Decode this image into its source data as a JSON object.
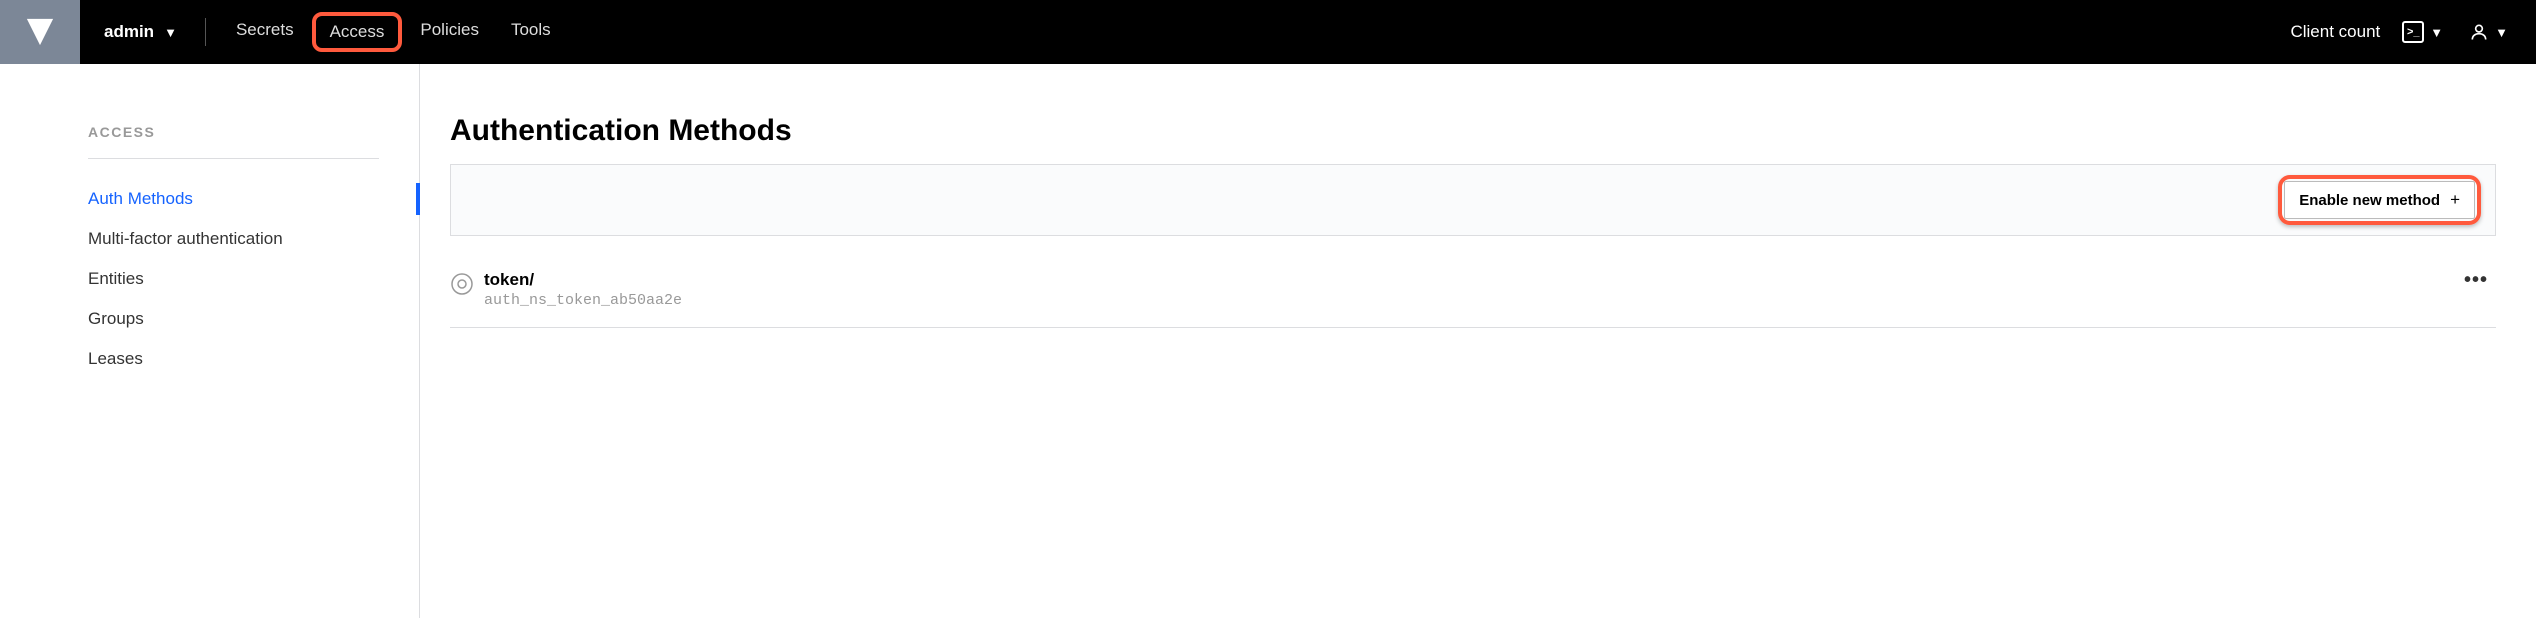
{
  "topbar": {
    "namespace": "admin",
    "tabs": [
      {
        "label": "Secrets",
        "active": false
      },
      {
        "label": "Access",
        "active": true,
        "highlight": true
      },
      {
        "label": "Policies",
        "active": false
      },
      {
        "label": "Tools",
        "active": false
      }
    ],
    "client_count": "Client count"
  },
  "sidebar": {
    "header": "ACCESS",
    "items": [
      {
        "label": "Auth Methods",
        "active": true
      },
      {
        "label": "Multi-factor authentication",
        "active": false
      },
      {
        "label": "Entities",
        "active": false
      },
      {
        "label": "Groups",
        "active": false
      },
      {
        "label": "Leases",
        "active": false
      }
    ]
  },
  "main": {
    "title": "Authentication Methods",
    "enable_btn": "Enable new method",
    "methods": [
      {
        "name": "token/",
        "id": "auth_ns_token_ab50aa2e"
      }
    ]
  }
}
